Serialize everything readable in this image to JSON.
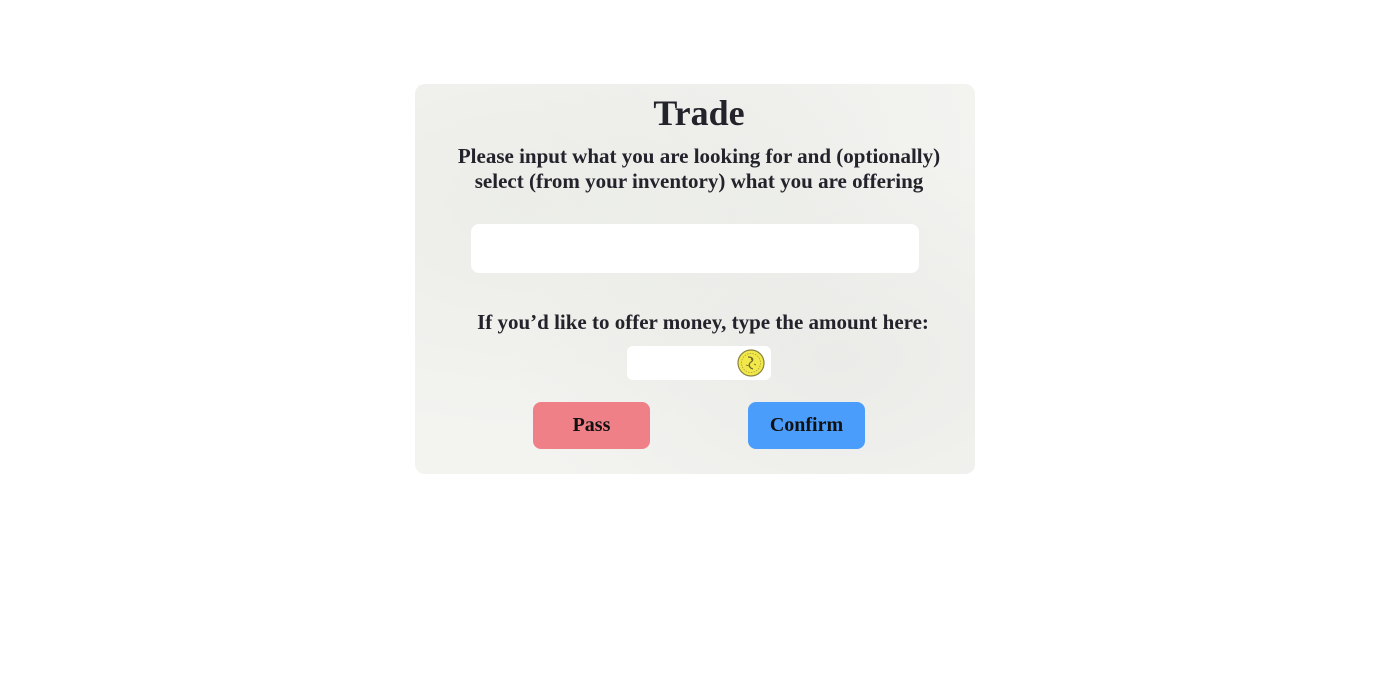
{
  "panel": {
    "title": "Trade",
    "instructions": "Please input what you are looking for and (optionally) select (from your inventory) what you are offering",
    "want_input": {
      "value": "",
      "placeholder": ""
    },
    "money_label": "If you’d like to offer money, type the amount here:",
    "money_input": {
      "value": "",
      "placeholder": ""
    },
    "money_icon": "coin-icon",
    "buttons": {
      "pass_label": "Pass",
      "confirm_label": "Confirm"
    }
  },
  "colors": {
    "pass": "#f08088",
    "confirm": "#4a9dfb",
    "panel_bg": "#f3f3f0",
    "coin": "#f2e84a"
  }
}
